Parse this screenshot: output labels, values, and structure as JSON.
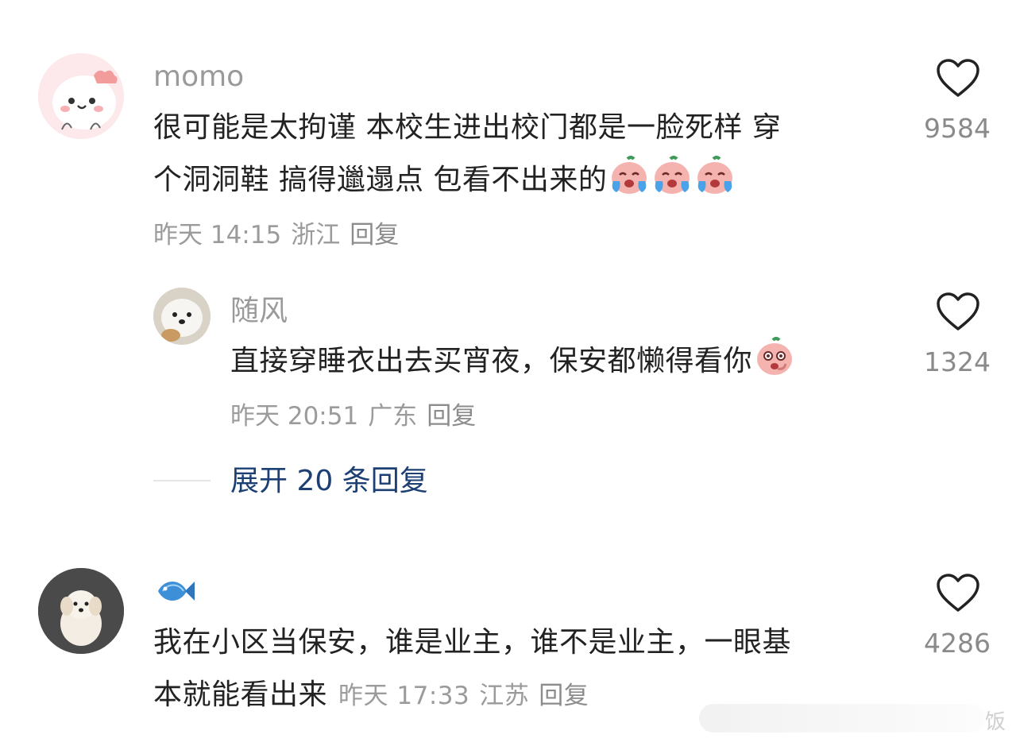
{
  "comments": [
    {
      "username": "momo",
      "text_line1": "很可能是太拘谨 本校生进出校门都是一脸死样  穿",
      "text_line2": "个洞洞鞋 搞得邋遢点 包看不出来的",
      "emojis": [
        "crying-face-icon",
        "crying-face-icon",
        "crying-face-icon"
      ],
      "time": "昨天 14:15",
      "location": "浙江",
      "reply_label": "回复",
      "likes": "9584"
    },
    {
      "username": "随风",
      "text": "直接穿睡衣出去买宵夜，保安都懒得看你",
      "emojis": [
        "laughing-face-icon"
      ],
      "time": "昨天 20:51",
      "location": "广东",
      "reply_label": "回复",
      "likes": "1324"
    },
    {
      "username_icon": "fish-icon",
      "text_line1": "我在小区当保安，谁是业主，谁不是业主，一眼基",
      "text_line2": "本就能看出来",
      "time": "昨天 17:33",
      "location": "江苏",
      "reply_label": "回复",
      "likes": "4286"
    }
  ],
  "expand_replies": "展开 20 条回复",
  "watermark": "饭",
  "colors": {
    "link_blue": "#1c3f74",
    "meta_gray": "#9b9b9b",
    "emoji_pink": "#f5b3b0"
  }
}
